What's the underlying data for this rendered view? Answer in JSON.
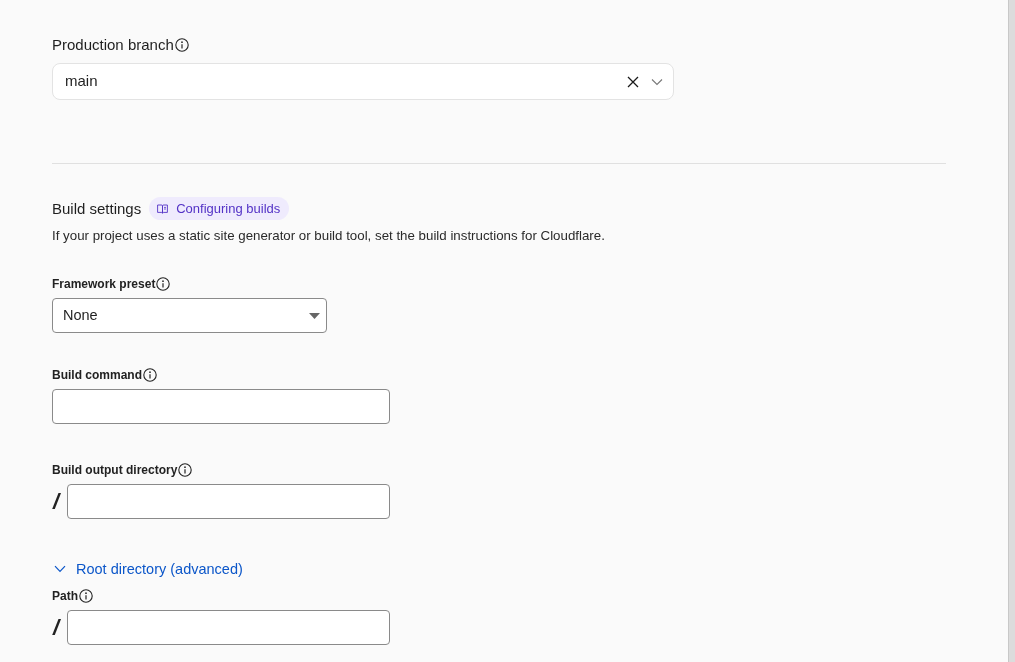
{
  "production_branch": {
    "label": "Production branch",
    "value": "main"
  },
  "build_settings": {
    "title": "Build settings",
    "docs_link": "Configuring builds",
    "description": "If your project uses a static site generator or build tool, set the build instructions for Cloudflare."
  },
  "fields": [
    {
      "kind": "select",
      "label": "Framework preset",
      "value": "None"
    },
    {
      "kind": "text",
      "label": "Build command"
    },
    {
      "kind": "path",
      "label": "Build output directory",
      "prefix": "/"
    }
  ],
  "root_directory": {
    "toggle": "Root directory (advanced)",
    "expanded": true,
    "fields": [
      {
        "kind": "path",
        "label": "Path",
        "prefix": "/"
      }
    ]
  }
}
